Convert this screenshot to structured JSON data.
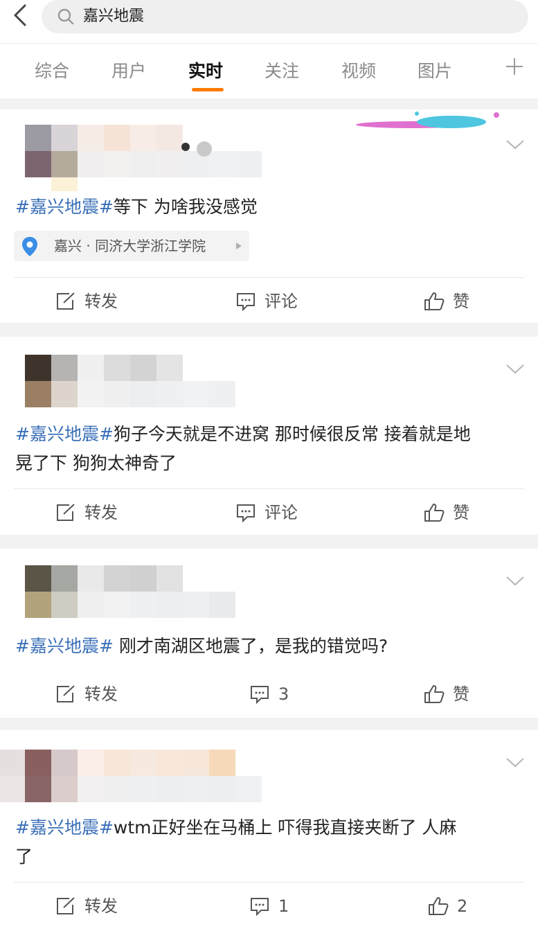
{
  "search": {
    "query": "嘉兴地震"
  },
  "tabs": [
    {
      "label": "综合"
    },
    {
      "label": "用户"
    },
    {
      "label": "实时"
    },
    {
      "label": "关注"
    },
    {
      "label": "视频"
    },
    {
      "label": "图片"
    }
  ],
  "active_tab": "实时",
  "colors": {
    "accent": "#ff7a00",
    "hashtag": "#3a6fb8"
  },
  "posts": [
    {
      "hashtag": "#嘉兴地震#",
      "text": "等下 为啥我没感觉",
      "location": "嘉兴 · 同济大学浙江学院",
      "actions": {
        "repost": "转发",
        "comment": "评论",
        "like": "赞"
      }
    },
    {
      "hashtag": "#嘉兴地震#",
      "text_line1": "狗子今天就是不进窝 那时候很反常 接着就是地",
      "text_line2": "晃了下 狗狗太神奇了",
      "actions": {
        "repost": "转发",
        "comment": "评论",
        "like": "赞"
      }
    },
    {
      "hashtag": "#嘉兴地震#",
      "text": " 刚才南湖区地震了，是我的错觉吗?",
      "actions": {
        "repost": "转发",
        "comment": "3",
        "like": "赞"
      }
    },
    {
      "hashtag": "#嘉兴地震#",
      "text_line1": "wtm正好坐在马桶上 吓得我直接夹断了 人麻",
      "text_line2": "了",
      "actions": {
        "repost": "转发",
        "comment": "1",
        "like": "2"
      }
    }
  ]
}
